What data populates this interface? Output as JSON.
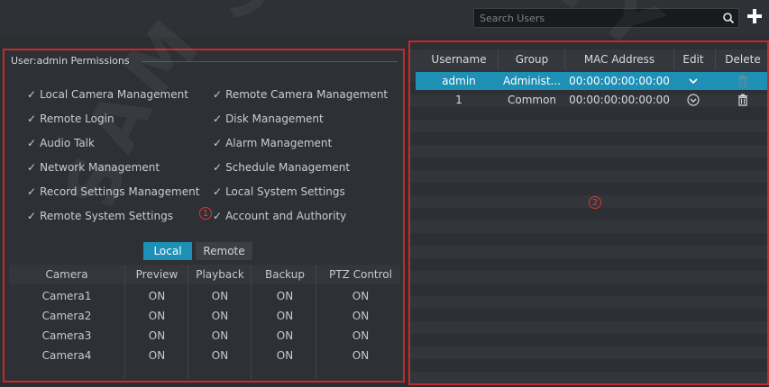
{
  "search": {
    "placeholder": "Search Users"
  },
  "permissions": {
    "header": "User:admin Permissions",
    "items_left": [
      "Local Camera Management",
      "Remote Login",
      "Audio Talk",
      "Network Management",
      "Record Settings Management",
      "Remote System Settings"
    ],
    "items_right": [
      "Remote Camera Management",
      "Disk Management",
      "Alarm Management",
      "Schedule Management",
      "Local System Settings",
      "Account and Authority"
    ],
    "check_glyph": "✓",
    "marker1": "1"
  },
  "tabs": {
    "local": "Local",
    "remote": "Remote"
  },
  "camera_table": {
    "headers": [
      "Camera",
      "Preview",
      "Playback",
      "Backup",
      "PTZ Control"
    ],
    "rows": [
      [
        "Camera1",
        "ON",
        "ON",
        "ON",
        "ON"
      ],
      [
        "Camera2",
        "ON",
        "ON",
        "ON",
        "ON"
      ],
      [
        "Camera3",
        "ON",
        "ON",
        "ON",
        "ON"
      ],
      [
        "Camera4",
        "ON",
        "ON",
        "ON",
        "ON"
      ]
    ]
  },
  "user_table": {
    "headers": [
      "Username",
      "Group",
      "MAC Address",
      "Edit",
      "Delete"
    ],
    "rows": [
      {
        "username": "admin",
        "group": "Administ...",
        "mac": "00:00:00:00:00:00",
        "selected": true
      },
      {
        "username": "1",
        "group": "Common",
        "mac": "00:00:00:00:00:00",
        "selected": false
      }
    ],
    "marker2": "2"
  },
  "colors": {
    "accent": "#1e8fb5",
    "highlight_border": "#c42a2a"
  },
  "watermark": "SAM SECURITY"
}
